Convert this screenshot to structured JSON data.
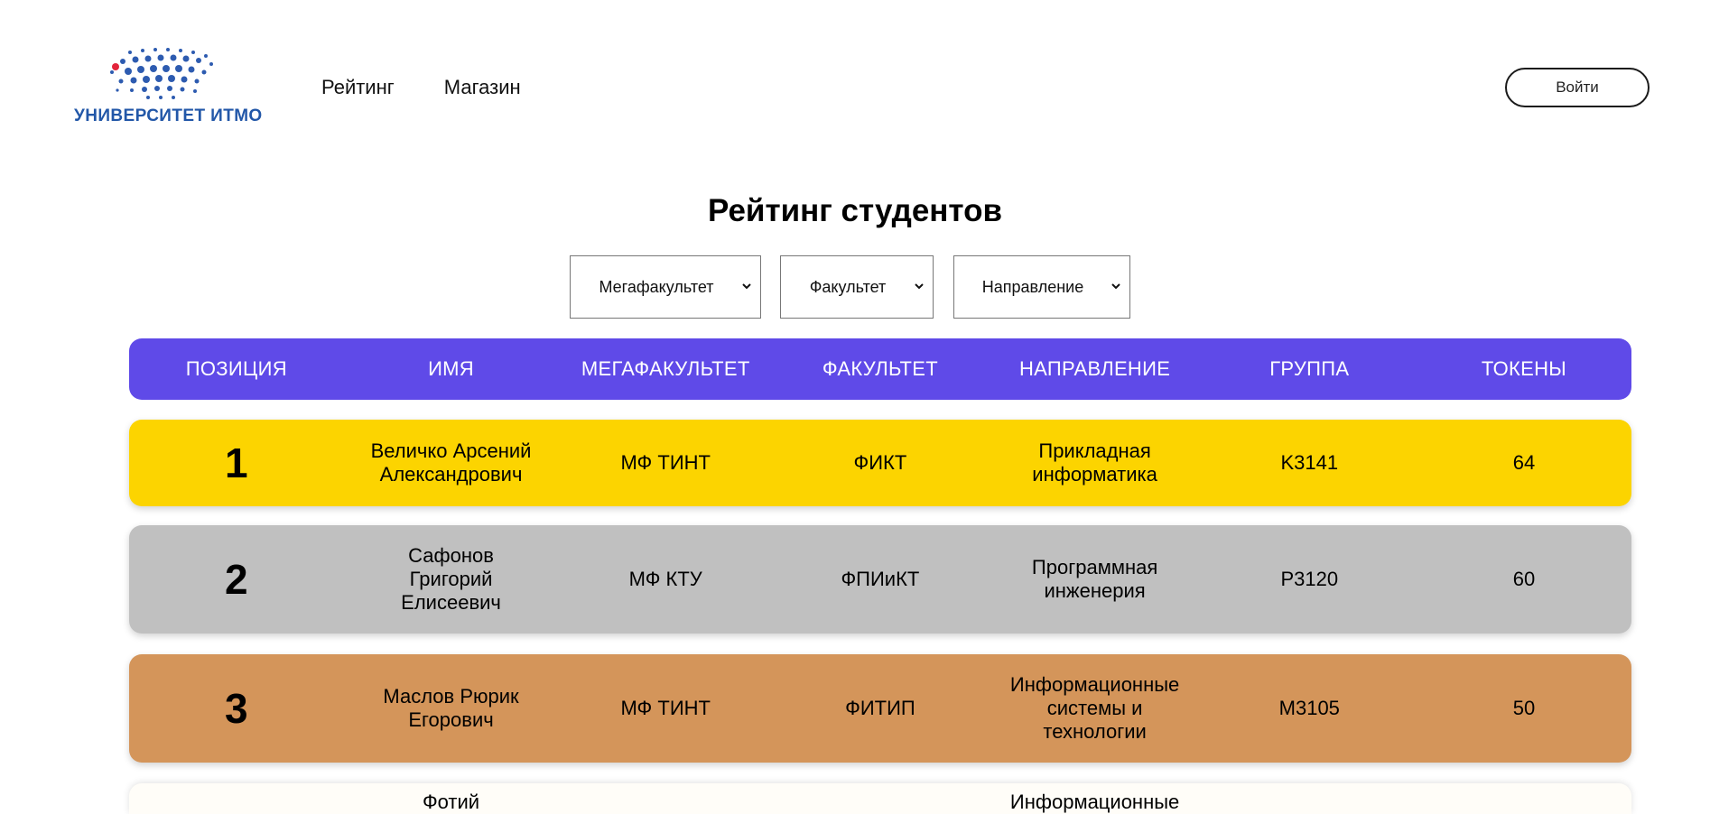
{
  "header": {
    "logo_text": "УНИВЕРСИТЕТ ИТМО",
    "nav": [
      "Рейтинг",
      "Магазин"
    ],
    "login_label": "Войти"
  },
  "page": {
    "title": "Рейтинг студентов"
  },
  "filters": [
    "Мегафакультет",
    "Факультет",
    "Направление"
  ],
  "table": {
    "headers": [
      "ПОЗИЦИЯ",
      "ИМЯ",
      "МЕГАФАКУЛЬТЕТ",
      "ФАКУЛЬТЕТ",
      "НАПРАВЛЕНИЕ",
      "ГРУППА",
      "ТОКЕНЫ"
    ],
    "rows": [
      {
        "position": "1",
        "name": "Величко Арсений Александрович",
        "megafaculty": "МФ ТИНТ",
        "faculty": "ФИКТ",
        "direction": "Прикладная информатика",
        "group": "K3141",
        "tokens": "64"
      },
      {
        "position": "2",
        "name": "Сафонов Григорий Елисеевич",
        "megafaculty": "МФ КТУ",
        "faculty": "ФПИиКТ",
        "direction": "Программная инженерия",
        "group": "P3120",
        "tokens": "60"
      },
      {
        "position": "3",
        "name": "Маслов Рюрик Егорович",
        "megafaculty": "МФ ТИНТ",
        "faculty": "ФИТИП",
        "direction": "Информационные системы и технологии",
        "group": "M3105",
        "tokens": "50"
      },
      {
        "position": "",
        "name": "Фотий",
        "megafaculty": "",
        "faculty": "",
        "direction": "Информационные",
        "group": "",
        "tokens": ""
      }
    ]
  },
  "colors": {
    "accent": "#5f4ae8",
    "gold": "#fcd400",
    "silver": "#c0c0c0",
    "bronze": "#d4955a",
    "logo_blue": "#2257a8"
  }
}
